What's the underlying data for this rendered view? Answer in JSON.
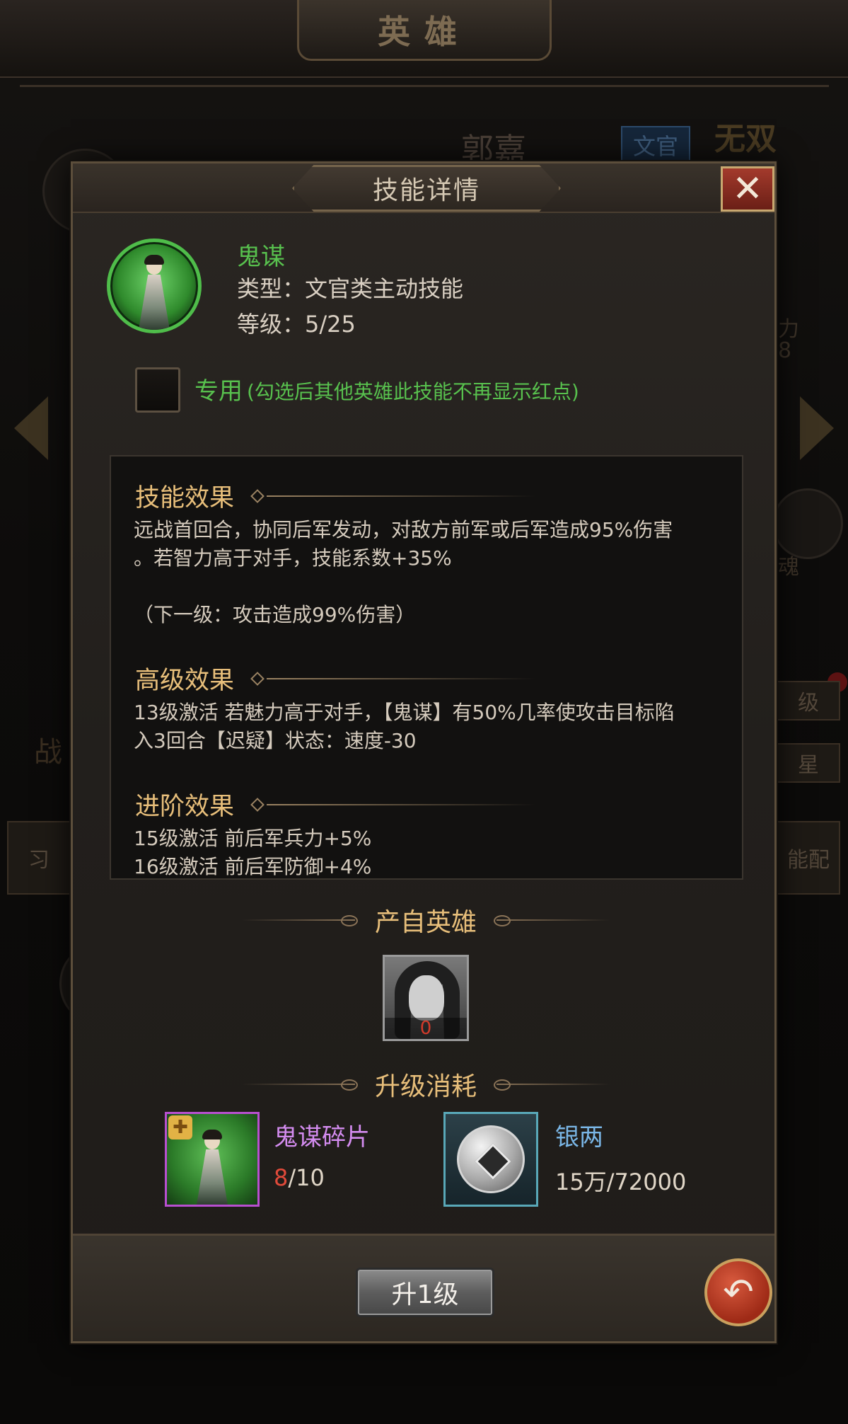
{
  "background": {
    "screen_title": "英雄",
    "hero_name": "郭嘉",
    "hero_type": "文官",
    "badge": "无双",
    "side_stat_label": "力",
    "side_stat_value": "8",
    "side_soul": "魂",
    "side_level_btn": "级",
    "side_star_btn": "星",
    "side_skill_btn": "能配",
    "side_learn": "习",
    "side_war": "战"
  },
  "dialog": {
    "title": "技能详情",
    "close_glyph": "✕",
    "skill": {
      "name": "鬼谋",
      "type_line": "类型：文官类主动技能",
      "level_line": "等级：5/25"
    },
    "exclusive": {
      "checked": false,
      "label": "专用",
      "note": "(勾选后其他英雄此技能不再显示红点)"
    },
    "effects": [
      {
        "title": "技能效果",
        "text": "远战首回合，协同后军发动，对敌方前军或后军造成95%伤害\n。若智力高于对手，技能系数+35%\n\n（下一级：攻击造成99%伤害）"
      },
      {
        "title": "高级效果",
        "text": "13级激活 若魅力高于对手，【鬼谋】有50%几率使攻击目标陷\n入3回合【迟疑】状态：速度-30"
      },
      {
        "title": "进阶效果",
        "text": "15级激活 前后军兵力+5%\n16级激活 前后军防御+4%"
      }
    ],
    "source_heroes": {
      "title": "产自英雄",
      "hero_count": "0"
    },
    "upgrade_cost": {
      "title": "升级消耗",
      "items": [
        {
          "name": "鬼谋碎片",
          "current": "8",
          "required": "/10",
          "name_color": "#d48cf0",
          "current_color": "#e04a3a"
        },
        {
          "name": "银两",
          "current": "15万",
          "required": "/72000",
          "name_color": "#7ab6e6",
          "current_color": "#e0d6c7"
        }
      ]
    },
    "upgrade_button": "升1级",
    "back_glyph": "↶"
  }
}
